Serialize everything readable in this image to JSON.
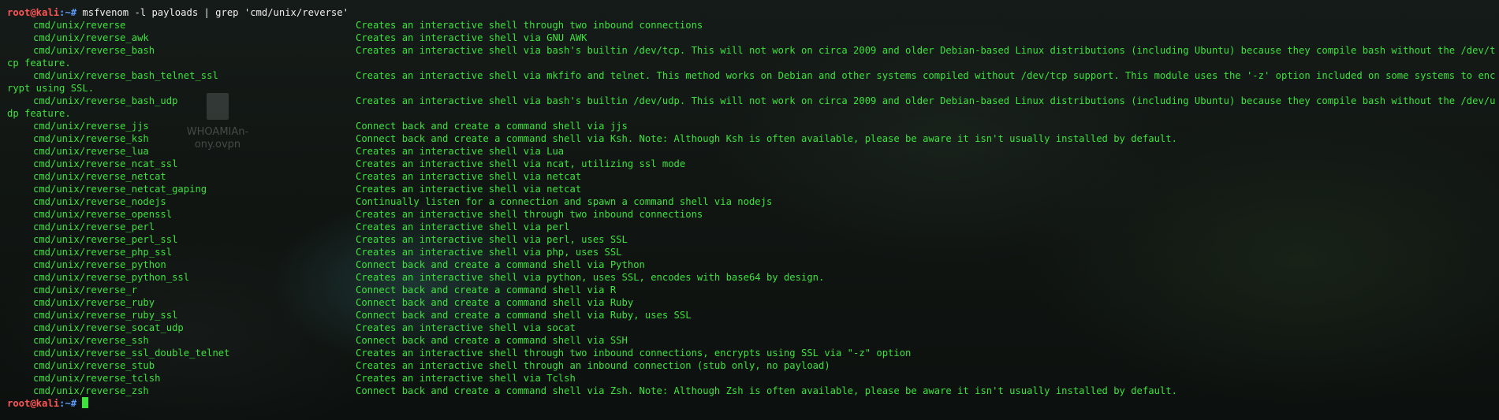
{
  "desktop": {
    "file_label": "WHOAMIAn-\nony.ovpn"
  },
  "prompt": {
    "user_host": "root@kali",
    "path": ":~#",
    "command": "msfvenom -l payloads | grep 'cmd/unix/reverse'"
  },
  "payloads": [
    {
      "name": "cmd/unix/reverse",
      "description": "Creates an interactive shell through two inbound connections"
    },
    {
      "name": "cmd/unix/reverse_awk",
      "description": "Creates an interactive shell via GNU AWK"
    },
    {
      "name": "cmd/unix/reverse_bash",
      "description": "Creates an interactive shell via bash's builtin /dev/tcp. This will not work on circa 2009 and older Debian-based Linux distributions (including Ubuntu) because they compile bash without the /dev/tcp feature."
    },
    {
      "name": "cmd/unix/reverse_bash_telnet_ssl",
      "description": "Creates an interactive shell via mkfifo and telnet. This method works on Debian and other systems compiled without /dev/tcp support. This module uses the '-z' option included on some systems to encrypt using SSL."
    },
    {
      "name": "cmd/unix/reverse_bash_udp",
      "description": "Creates an interactive shell via bash's builtin /dev/udp. This will not work on circa 2009 and older Debian-based Linux distributions (including Ubuntu) because they compile bash without the /dev/udp feature."
    },
    {
      "name": "cmd/unix/reverse_jjs",
      "description": "Connect back and create a command shell via jjs"
    },
    {
      "name": "cmd/unix/reverse_ksh",
      "description": "Connect back and create a command shell via Ksh. Note: Although Ksh is often available, please be aware it isn't usually installed by default."
    },
    {
      "name": "cmd/unix/reverse_lua",
      "description": "Creates an interactive shell via Lua"
    },
    {
      "name": "cmd/unix/reverse_ncat_ssl",
      "description": "Creates an interactive shell via ncat, utilizing ssl mode"
    },
    {
      "name": "cmd/unix/reverse_netcat",
      "description": "Creates an interactive shell via netcat"
    },
    {
      "name": "cmd/unix/reverse_netcat_gaping",
      "description": "Creates an interactive shell via netcat"
    },
    {
      "name": "cmd/unix/reverse_nodejs",
      "description": "Continually listen for a connection and spawn a command shell via nodejs"
    },
    {
      "name": "cmd/unix/reverse_openssl",
      "description": "Creates an interactive shell through two inbound connections"
    },
    {
      "name": "cmd/unix/reverse_perl",
      "description": "Creates an interactive shell via perl"
    },
    {
      "name": "cmd/unix/reverse_perl_ssl",
      "description": "Creates an interactive shell via perl, uses SSL"
    },
    {
      "name": "cmd/unix/reverse_php_ssl",
      "description": "Creates an interactive shell via php, uses SSL"
    },
    {
      "name": "cmd/unix/reverse_python",
      "description": "Connect back and create a command shell via Python"
    },
    {
      "name": "cmd/unix/reverse_python_ssl",
      "description": "Creates an interactive shell via python, uses SSL, encodes with base64 by design."
    },
    {
      "name": "cmd/unix/reverse_r",
      "description": "Connect back and create a command shell via R"
    },
    {
      "name": "cmd/unix/reverse_ruby",
      "description": "Connect back and create a command shell via Ruby"
    },
    {
      "name": "cmd/unix/reverse_ruby_ssl",
      "description": "Connect back and create a command shell via Ruby, uses SSL"
    },
    {
      "name": "cmd/unix/reverse_socat_udp",
      "description": "Creates an interactive shell via socat"
    },
    {
      "name": "cmd/unix/reverse_ssh",
      "description": "Connect back and create a command shell via SSH"
    },
    {
      "name": "cmd/unix/reverse_ssl_double_telnet",
      "description": "Creates an interactive shell through two inbound connections, encrypts using SSL via \"-z\" option"
    },
    {
      "name": "cmd/unix/reverse_stub",
      "description": "Creates an interactive shell through an inbound connection (stub only, no payload)"
    },
    {
      "name": "cmd/unix/reverse_tclsh",
      "description": "Creates an interactive shell via Tclsh"
    },
    {
      "name": "cmd/unix/reverse_zsh",
      "description": "Connect back and create a command shell via Zsh. Note: Although Zsh is often available, please be aware it isn't usually installed by default."
    }
  ],
  "final_prompt": {
    "user_host": "root@kali",
    "path": ":~#"
  },
  "colors": {
    "output_green": "#3ee13e",
    "prompt_red": "#ff5555",
    "prompt_blue": "#5c9cff",
    "command_white": "#eeeeee"
  }
}
